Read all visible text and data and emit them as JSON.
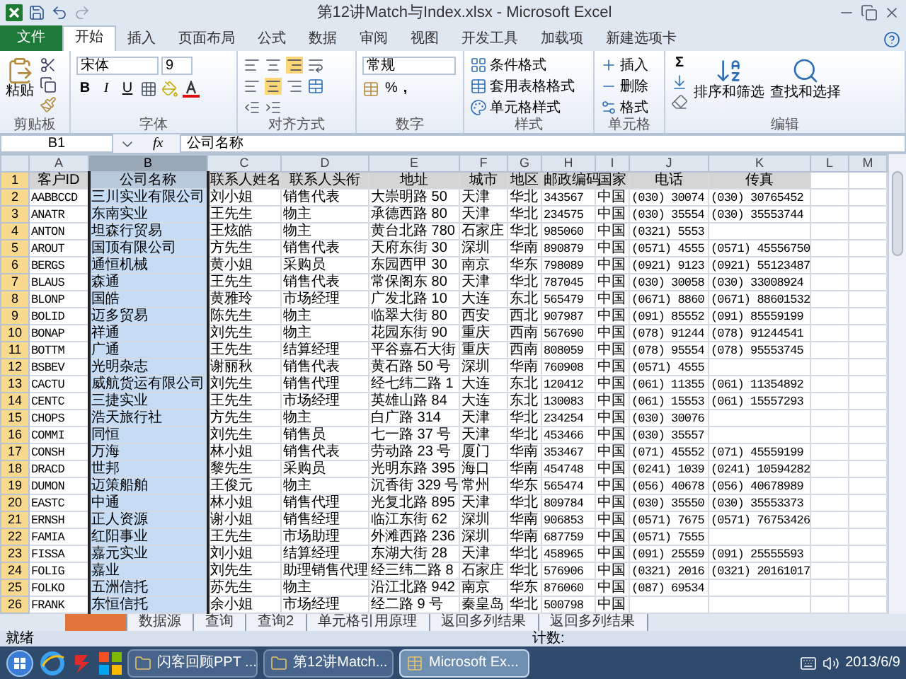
{
  "window": {
    "title": "第12讲Match与Index.xlsx - Microsoft Excel"
  },
  "ribbon_tabs": [
    {
      "label": "文件",
      "kind": "file",
      "selected": false
    },
    {
      "label": "开始",
      "kind": "tab",
      "selected": true
    },
    {
      "label": "插入",
      "kind": "tab",
      "selected": false
    },
    {
      "label": "页面布局",
      "kind": "tab",
      "selected": false
    },
    {
      "label": "公式",
      "kind": "tab",
      "selected": false
    },
    {
      "label": "数据",
      "kind": "tab",
      "selected": false
    },
    {
      "label": "审阅",
      "kind": "tab",
      "selected": false
    },
    {
      "label": "视图",
      "kind": "tab",
      "selected": false
    },
    {
      "label": "开发工具",
      "kind": "tab",
      "selected": false
    },
    {
      "label": "加载项",
      "kind": "tab",
      "selected": false
    },
    {
      "label": "新建选项卡",
      "kind": "tab",
      "selected": false
    }
  ],
  "ribbon": {
    "clipboard": {
      "paste": "粘贴",
      "label": "剪贴板"
    },
    "font": {
      "name": "宋体",
      "size": "9",
      "bold": "B",
      "italic": "I",
      "underline": "U",
      "label": "字体"
    },
    "alignment": {
      "label": "对齐方式"
    },
    "number": {
      "format": "常规",
      "percent": "%",
      "comma": ",",
      "label": "数字"
    },
    "styles": {
      "items": [
        "条件格式",
        "套用表格格式",
        "单元格样式"
      ],
      "label": "样式"
    },
    "cells": {
      "items": [
        "插入",
        "删除",
        "格式"
      ],
      "label": "单元格"
    },
    "editing": {
      "sum": "Σ",
      "items": [
        "排序和筛选",
        "查找和选择"
      ],
      "label": "编辑"
    }
  },
  "formula_bar": {
    "name_box": "B1",
    "function_label": "fx",
    "formula": "公司名称"
  },
  "sheet": {
    "columns": [
      {
        "letter": "A",
        "selected": false
      },
      {
        "letter": "B",
        "selected": true
      },
      {
        "letter": "C",
        "selected": false
      },
      {
        "letter": "D",
        "selected": false
      },
      {
        "letter": "E",
        "selected": false
      },
      {
        "letter": "F",
        "selected": false
      },
      {
        "letter": "G",
        "selected": false
      },
      {
        "letter": "H",
        "selected": false
      },
      {
        "letter": "I",
        "selected": false
      },
      {
        "letter": "J",
        "selected": false
      },
      {
        "letter": "K",
        "selected": false
      },
      {
        "letter": "L",
        "selected": false
      },
      {
        "letter": "M",
        "selected": false
      }
    ],
    "rows": [
      {
        "number": "1",
        "kind": "header",
        "cells": [
          "客户ID",
          "公司名称",
          "联系人姓名",
          "联系人头衔",
          "地址",
          "城市",
          "地区",
          "邮政编码",
          "国家",
          "电话",
          "传真"
        ]
      },
      {
        "number": "2",
        "kind": "data",
        "cells": [
          "AABBCCD",
          "三川实业有限公司",
          "刘小姐",
          "销售代表",
          "大崇明路 50",
          "天津",
          "华北",
          "343567",
          "中国",
          "(030) 30074",
          "(030) 30765452"
        ]
      },
      {
        "number": "3",
        "kind": "data",
        "cells": [
          "ANATR",
          "东南实业",
          "王先生",
          "物主",
          "承德西路 80",
          "天津",
          "华北",
          "234575",
          "中国",
          "(030) 35554",
          "(030) 35553744"
        ]
      },
      {
        "number": "4",
        "kind": "data",
        "cells": [
          "ANTON",
          "坦森行贸易",
          "王炫皓",
          "物主",
          "黄台北路 780",
          "石家庄",
          "华北",
          "985060",
          "中国",
          "(0321) 5553",
          null
        ]
      },
      {
        "number": "5",
        "kind": "data",
        "cells": [
          "AROUT",
          "国顶有限公司",
          "方先生",
          "销售代表",
          "天府东街 30",
          "深圳",
          "华南",
          "890879",
          "中国",
          "(0571) 4555",
          "(0571) 45556750"
        ]
      },
      {
        "number": "6",
        "kind": "data",
        "cells": [
          "BERGS",
          "通恒机械",
          "黄小姐",
          "采购员",
          "东园西甲 30",
          "南京",
          "华东",
          "798089",
          "中国",
          "(0921) 9123",
          "(0921) 55123487"
        ]
      },
      {
        "number": "7",
        "kind": "data",
        "cells": [
          "BLAUS",
          "森通",
          "王先生",
          "销售代表",
          "常保阁东 80",
          "天津",
          "华北",
          "787045",
          "中国",
          "(030) 30058",
          "(030)  33008924"
        ]
      },
      {
        "number": "8",
        "kind": "data",
        "cells": [
          "BLONP",
          "国皓",
          "黄雅玲",
          "市场经理",
          "广发北路 10",
          "大连",
          "东北",
          "565479",
          "中国",
          "(0671) 8860",
          "(0671) 88601532"
        ]
      },
      {
        "number": "9",
        "kind": "data",
        "cells": [
          "BOLID",
          "迈多贸易",
          "陈先生",
          "物主",
          "临翠大街 80",
          "西安",
          "西北",
          "907987",
          "中国",
          "(091) 85552",
          "(091) 85559199"
        ]
      },
      {
        "number": "10",
        "kind": "data",
        "cells": [
          "BONAP",
          "祥通",
          "刘先生",
          "物主",
          "花园东街 90",
          "重庆",
          "西南",
          "567690",
          "中国",
          "(078) 91244",
          "(078) 91244541"
        ]
      },
      {
        "number": "11",
        "kind": "data",
        "cells": [
          "BOTTM",
          "广通",
          "王先生",
          "结算经理",
          "平谷嘉石大街",
          "重庆",
          "西南",
          "808059",
          "中国",
          "(078) 95554",
          "(078) 95553745"
        ]
      },
      {
        "number": "12",
        "kind": "data",
        "cells": [
          "BSBEV",
          "光明杂志",
          "谢丽秋",
          "销售代表",
          "黄石路 50 号",
          "深圳",
          "华南",
          "760908",
          "中国",
          "(0571) 4555",
          null
        ]
      },
      {
        "number": "13",
        "kind": "data",
        "cells": [
          "CACTU",
          "威航货运有限公司",
          "刘先生",
          "销售代理",
          "经七纬二路 1",
          "大连",
          "东北",
          "120412",
          "中国",
          "(061) 11355",
          "(061) 11354892"
        ]
      },
      {
        "number": "14",
        "kind": "data",
        "cells": [
          "CENTC",
          "三捷实业",
          "王先生",
          "市场经理",
          "英雄山路 84",
          "大连",
          "东北",
          "130083",
          "中国",
          "(061) 15553",
          "(061) 15557293"
        ]
      },
      {
        "number": "15",
        "kind": "data",
        "cells": [
          "CHOPS",
          "浩天旅行社",
          "方先生",
          "物主",
          "白广路 314",
          "天津",
          "华北",
          "234254",
          "中国",
          "(030) 30076",
          null
        ]
      },
      {
        "number": "16",
        "kind": "data",
        "cells": [
          "COMMI",
          "同恒",
          "刘先生",
          "销售员",
          "七一路 37 号",
          "天津",
          "华北",
          "453466",
          "中国",
          "(030) 35557",
          null
        ]
      },
      {
        "number": "17",
        "kind": "data",
        "cells": [
          "CONSH",
          "万海",
          "林小姐",
          "销售代表",
          "劳动路 23 号",
          "厦门",
          "华南",
          "353467",
          "中国",
          "(071) 45552",
          "(071) 45559199"
        ]
      },
      {
        "number": "18",
        "kind": "data",
        "cells": [
          "DRACD",
          "世邦",
          "黎先生",
          "采购员",
          "光明东路 395",
          "海口",
          "华南",
          "454748",
          "中国",
          "(0241) 1039",
          "(0241) 10594282"
        ]
      },
      {
        "number": "19",
        "kind": "data",
        "cells": [
          "DUMON",
          "迈策船舶",
          "王俊元",
          "物主",
          "沉香街 329 号",
          "常州",
          "华东",
          "565474",
          "中国",
          "(056) 40678",
          "(056) 40678989"
        ]
      },
      {
        "number": "20",
        "kind": "data",
        "cells": [
          "EASTC",
          "中通",
          "林小姐",
          "销售代理",
          "光复北路 895",
          "天津",
          "华北",
          "809784",
          "中国",
          "(030) 35550",
          "(030) 35553373"
        ]
      },
      {
        "number": "21",
        "kind": "data",
        "cells": [
          "ERNSH",
          "正人资源",
          "谢小姐",
          "销售经理",
          "临江东街 62",
          "深圳",
          "华南",
          "906853",
          "中国",
          "(0571) 7675",
          "(0571) 76753426"
        ]
      },
      {
        "number": "22",
        "kind": "data",
        "cells": [
          "FAMIA",
          "红阳事业",
          "王先生",
          "市场助理",
          "外滩西路 236",
          "深圳",
          "华南",
          "687759",
          "中国",
          "(0571) 7555",
          null
        ]
      },
      {
        "number": "23",
        "kind": "data",
        "cells": [
          "FISSA",
          "嘉元实业",
          "刘小姐",
          "结算经理",
          "东湖大街 28",
          "天津",
          "华北",
          "458965",
          "中国",
          "(091) 25559",
          "(091) 25555593"
        ]
      },
      {
        "number": "24",
        "kind": "data",
        "cells": [
          "FOLIG",
          "嘉业",
          "刘先生",
          "助理销售代理",
          "经三纬二路 8",
          "石家庄",
          "华北",
          "576906",
          "中国",
          "(0321) 2016",
          "(0321) 20161017"
        ]
      },
      {
        "number": "25",
        "kind": "data",
        "cells": [
          "FOLKO",
          "五洲信托",
          "苏先生",
          "物主",
          "沿江北路 942",
          "南京",
          "华东",
          "876060",
          "中国",
          "(087) 69534",
          null
        ]
      },
      {
        "number": "26",
        "kind": "data",
        "cells": [
          "FRANK",
          "东恒信托",
          "余小姐",
          "市场经理",
          "经二路 9 号",
          "秦皇岛",
          "华北",
          "500798",
          "中国",
          null,
          null
        ]
      }
    ]
  },
  "sheet_tabs": [
    {
      "selected": true
    },
    {
      "label": "数据源",
      "selected": false
    },
    {
      "label": "查询",
      "selected": false
    },
    {
      "label": "查询2",
      "selected": false
    },
    {
      "label": "单元格引用原理",
      "selected": false
    },
    {
      "label": "返回多列结果",
      "selected": false
    },
    {
      "label": "返回多列结果",
      "selected": false
    }
  ],
  "status_bar": {
    "ready": "就绪",
    "count": "计数:"
  },
  "taskbar": {
    "buttons": [
      {
        "label": "闪客回顾PPT ...",
        "selected": false
      },
      {
        "label": "第12讲Match...",
        "selected": false
      },
      {
        "label": "Microsoft Ex...",
        "selected": true
      }
    ],
    "date": "2013/6/9"
  }
}
